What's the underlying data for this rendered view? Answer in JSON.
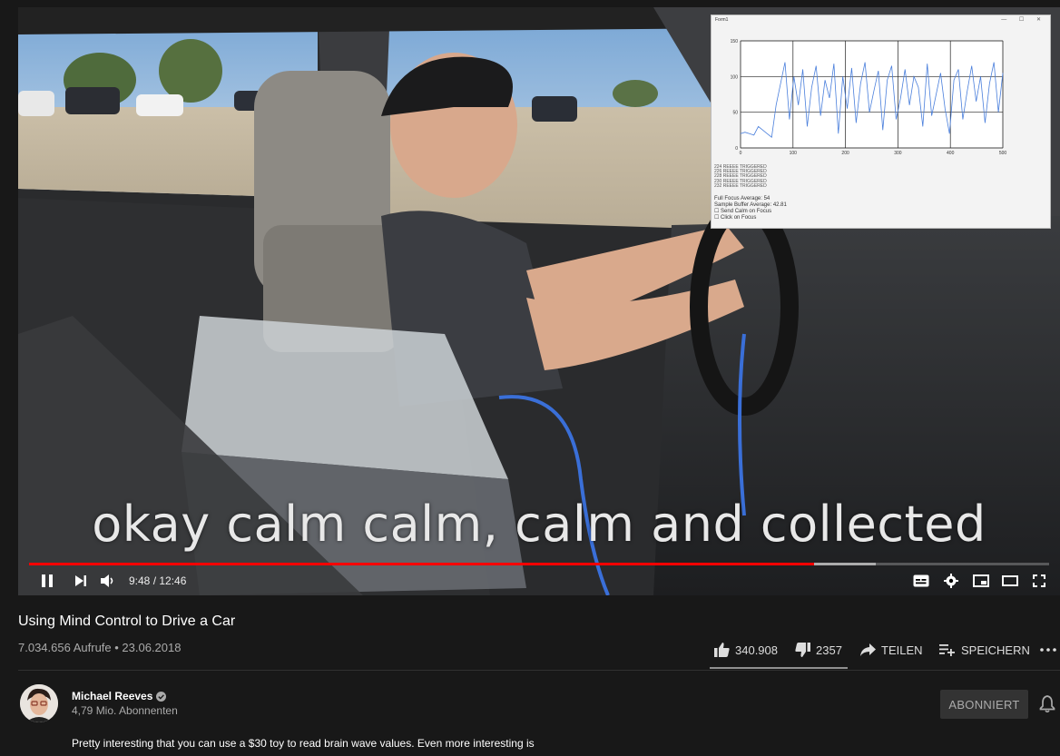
{
  "player": {
    "subtitle": "okay calm calm, calm and collected",
    "time": "9:48 / 12:46",
    "progress": {
      "played_fraction": 0.77,
      "buffered_fraction": 0.83
    }
  },
  "overlay_window": {
    "title": "Form1",
    "chart_data": {
      "type": "line",
      "x_ticks": [
        "0",
        "100",
        "200",
        "300",
        "400",
        "500"
      ],
      "y_ticks": [
        "0",
        "50",
        "100",
        "150"
      ],
      "xlim": [
        0,
        500
      ],
      "ylim": [
        0,
        150
      ],
      "series": [
        {
          "values": [
            20,
            22,
            20,
            18,
            30,
            25,
            20,
            15,
            60,
            90,
            120,
            40,
            100,
            60,
            110,
            30,
            85,
            115,
            45,
            95,
            70,
            118,
            20,
            100,
            55,
            112,
            35,
            90,
            120,
            50,
            80,
            108,
            25,
            95,
            115,
            40,
            70,
            110,
            60,
            100,
            85,
            30,
            118,
            45,
            75,
            105,
            55,
            20,
            95,
            110,
            40,
            80,
            115,
            65,
            100,
            35,
            90,
            120,
            50,
            105
          ]
        }
      ]
    },
    "log_lines": [
      "224 REEEE TRIGGERED",
      "226 REEEE TRIGGERED",
      "228 REEEE TRIGGERED",
      "230 REEEE TRIGGERED",
      "232 REEEE TRIGGERED"
    ],
    "full_focus": "Full Focus Average: 54",
    "sample_buffer": "Sample Buffer Average: 42.81",
    "option1": "Send Calm on Focus",
    "option2": "Click on Focus"
  },
  "video": {
    "title": "Using Mind Control to Drive a Car",
    "meta": "7.034.656 Aufrufe • 23.06.2018"
  },
  "actions": {
    "likes": "340.908",
    "dislikes": "2357",
    "share": "TEILEN",
    "save": "SPEICHERN"
  },
  "channel": {
    "name": "Michael Reeves",
    "subscribers": "4,79 Mio. Abonnenten",
    "subscribe_label": "ABONNIERT"
  },
  "description": "Pretty interesting that you can use a $30 toy to read brain wave values. Even more interesting is",
  "colors": {
    "progress": "#ff0000",
    "background": "#181818"
  }
}
